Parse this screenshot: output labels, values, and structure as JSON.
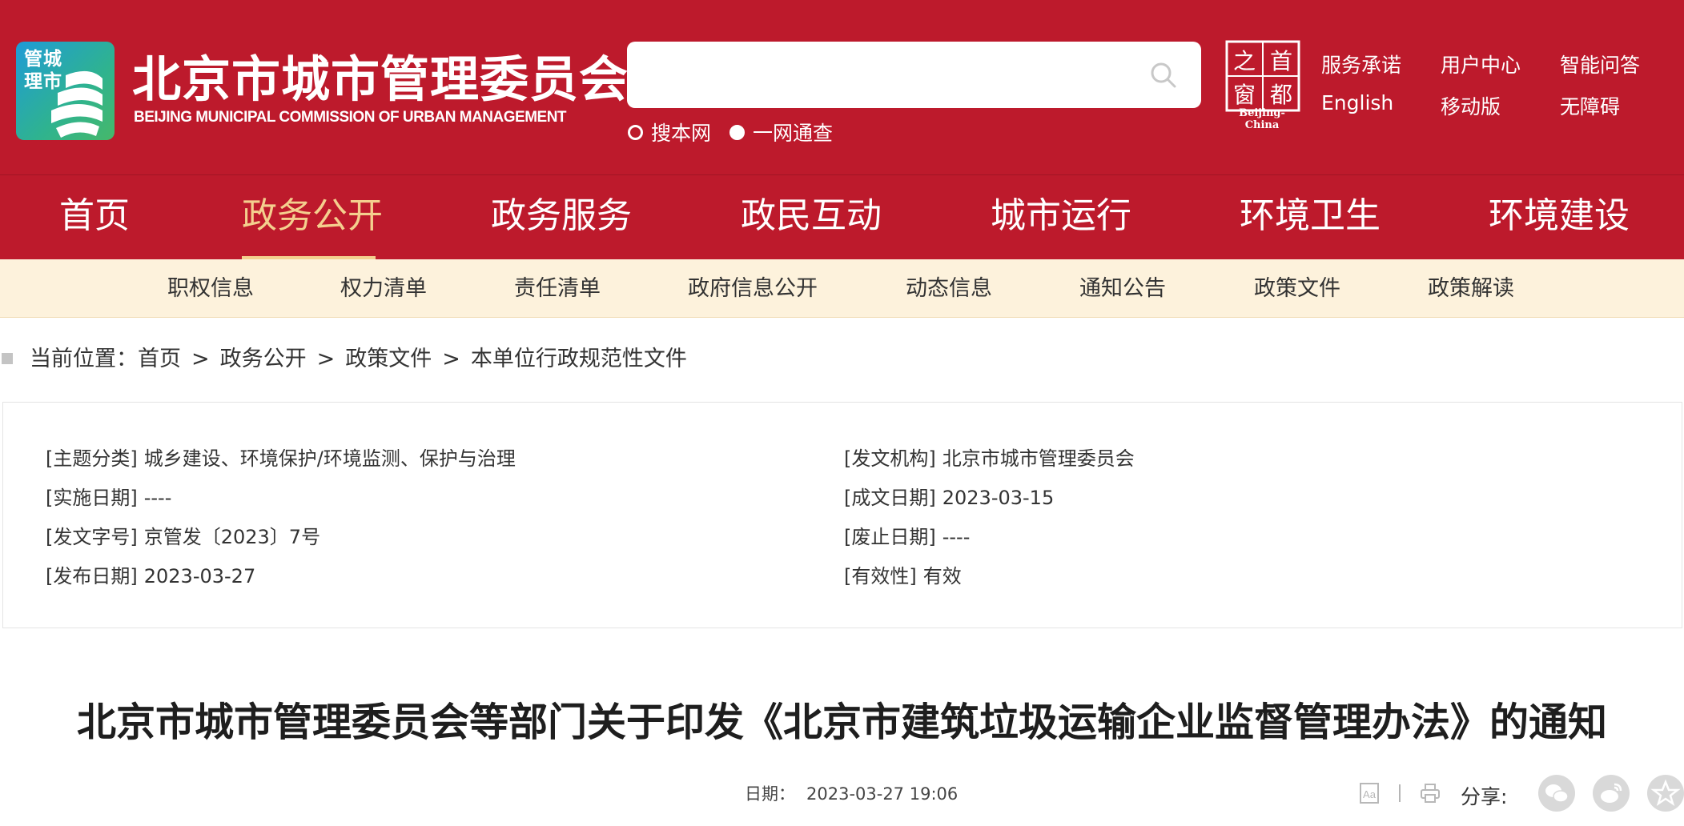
{
  "header": {
    "emblem_text": "管城理市",
    "title": "北京市城市管理委员会",
    "subtitle": "BEIJING MUNICIPAL COMMISSION OF URBAN MANAGEMENT",
    "search": {
      "value": "",
      "placeholder": "",
      "scopes": [
        {
          "label": "搜本网",
          "selected": false
        },
        {
          "label": "一网通查",
          "selected": true
        }
      ]
    },
    "capital_logo": {
      "chars": [
        "之",
        "首",
        "窗",
        "都"
      ],
      "caption": "Beijing-China"
    },
    "top_links": [
      {
        "label": "服务承诺"
      },
      {
        "label": "用户中心"
      },
      {
        "label": "智能问答"
      },
      {
        "label": "English"
      },
      {
        "label": "移动版"
      },
      {
        "label": "无障碍"
      }
    ]
  },
  "nav": {
    "items": [
      {
        "label": "首页"
      },
      {
        "label": "政务公开"
      },
      {
        "label": "政务服务"
      },
      {
        "label": "政民互动"
      },
      {
        "label": "城市运行"
      },
      {
        "label": "环境卫生"
      },
      {
        "label": "环境建设"
      }
    ],
    "active": "政务公开"
  },
  "subnav": {
    "items": [
      {
        "label": "职权信息"
      },
      {
        "label": "权力清单"
      },
      {
        "label": "责任清单"
      },
      {
        "label": "政府信息公开"
      },
      {
        "label": "动态信息"
      },
      {
        "label": "通知公告"
      },
      {
        "label": "政策文件"
      },
      {
        "label": "政策解读"
      }
    ]
  },
  "breadcrumb": {
    "prefix": "当前位置：",
    "items": [
      "首页",
      "政务公开",
      "政策文件",
      "本单位行政规范性文件"
    ],
    "separator": ">"
  },
  "doc_info": {
    "left": [
      {
        "key": "[主题分类]",
        "value": "城乡建设、环境保护/环境监测、保护与治理"
      },
      {
        "key": "[实施日期]",
        "value": "----"
      },
      {
        "key": "[发文字号]",
        "value": "京管发〔2023〕7号"
      },
      {
        "key": "[发布日期]",
        "value": "2023-03-27"
      }
    ],
    "right": [
      {
        "key": "[发文机构]",
        "value": "北京市城市管理委员会"
      },
      {
        "key": "[成文日期]",
        "value": "2023-03-15"
      },
      {
        "key": "[废止日期]",
        "value": "----"
      },
      {
        "key": "[有效性]",
        "value": "有效"
      }
    ]
  },
  "document": {
    "title": "北京市城市管理委员会等部门关于印发《北京市建筑垃圾运输企业监督管理办法》的通知",
    "date_label": "日期：",
    "date": "2023-03-27 19:06",
    "share_label": "分享:"
  },
  "colors": {
    "brand_red": "#bd1a2c",
    "nav_active": "#f4cf8e",
    "subnav_bg": "#fdf2dc"
  },
  "icons": [
    "search-icon",
    "font-size-icon",
    "print-icon",
    "wechat-icon",
    "weibo-icon",
    "favorite-icon"
  ]
}
